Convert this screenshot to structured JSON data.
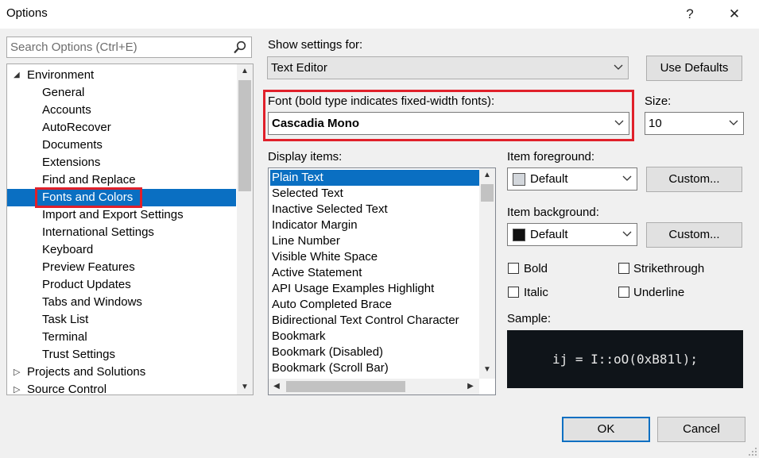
{
  "window": {
    "title": "Options",
    "help_glyph": "?",
    "close_glyph": "✕"
  },
  "search": {
    "placeholder": "Search Options (Ctrl+E)"
  },
  "tree": {
    "items": [
      {
        "label": "Environment",
        "expander": "◢"
      },
      {
        "label": "General"
      },
      {
        "label": "Accounts"
      },
      {
        "label": "AutoRecover"
      },
      {
        "label": "Documents"
      },
      {
        "label": "Extensions"
      },
      {
        "label": "Find and Replace"
      },
      {
        "label": "Fonts and Colors"
      },
      {
        "label": "Import and Export Settings"
      },
      {
        "label": "International Settings"
      },
      {
        "label": "Keyboard"
      },
      {
        "label": "Preview Features"
      },
      {
        "label": "Product Updates"
      },
      {
        "label": "Tabs and Windows"
      },
      {
        "label": "Task List"
      },
      {
        "label": "Terminal"
      },
      {
        "label": "Trust Settings"
      },
      {
        "label": "Projects and Solutions",
        "expander": "▷"
      },
      {
        "label": "Source Control",
        "expander": "▷"
      }
    ]
  },
  "show_settings": {
    "label": "Show settings for:",
    "value": "Text Editor"
  },
  "use_defaults_label": "Use Defaults",
  "font": {
    "label": "Font (bold type indicates fixed-width fonts):",
    "value": "Cascadia Mono"
  },
  "size": {
    "label": "Size:",
    "value": "10"
  },
  "display_items": {
    "label": "Display items:",
    "items": [
      "Plain Text",
      "Selected Text",
      "Inactive Selected Text",
      "Indicator Margin",
      "Line Number",
      "Visible White Space",
      "Active Statement",
      "API Usage Examples Highlight",
      "Auto Completed Brace",
      "Bidirectional Text Control Character",
      "Bookmark",
      "Bookmark (Disabled)",
      "Bookmark (Scroll Bar)"
    ]
  },
  "item_foreground": {
    "label": "Item foreground:",
    "value": "Default",
    "swatch_color": "#d3d7dc",
    "custom_label": "Custom..."
  },
  "item_background": {
    "label": "Item background:",
    "value": "Default",
    "swatch_color": "#111111",
    "custom_label": "Custom..."
  },
  "checkboxes": {
    "bold": "Bold",
    "strikethrough": "Strikethrough",
    "italic": "Italic",
    "underline": "Underline"
  },
  "sample": {
    "label": "Sample:",
    "text": "ij = I::oO(0xB81l);"
  },
  "buttons": {
    "ok": "OK",
    "cancel": "Cancel"
  },
  "colors": {
    "accent": "#0a6fc2",
    "highlight_box": "#e0202a"
  }
}
